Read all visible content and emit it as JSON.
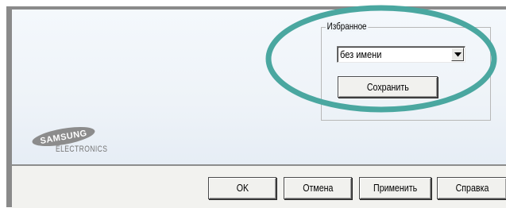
{
  "favorites": {
    "group_label": "Избранное",
    "select_value": "без имени",
    "save_label": "Сохранить"
  },
  "branding": {
    "logo_text": "SAMSUNG",
    "logo_subtext": "ELECTRONICS"
  },
  "buttons": {
    "ok": "OK",
    "cancel": "Отмена",
    "apply": "Применить",
    "help": "Справка"
  },
  "colors": {
    "highlight_ring": "#4aa7a0",
    "logo_gray": "#8c8c8c"
  }
}
